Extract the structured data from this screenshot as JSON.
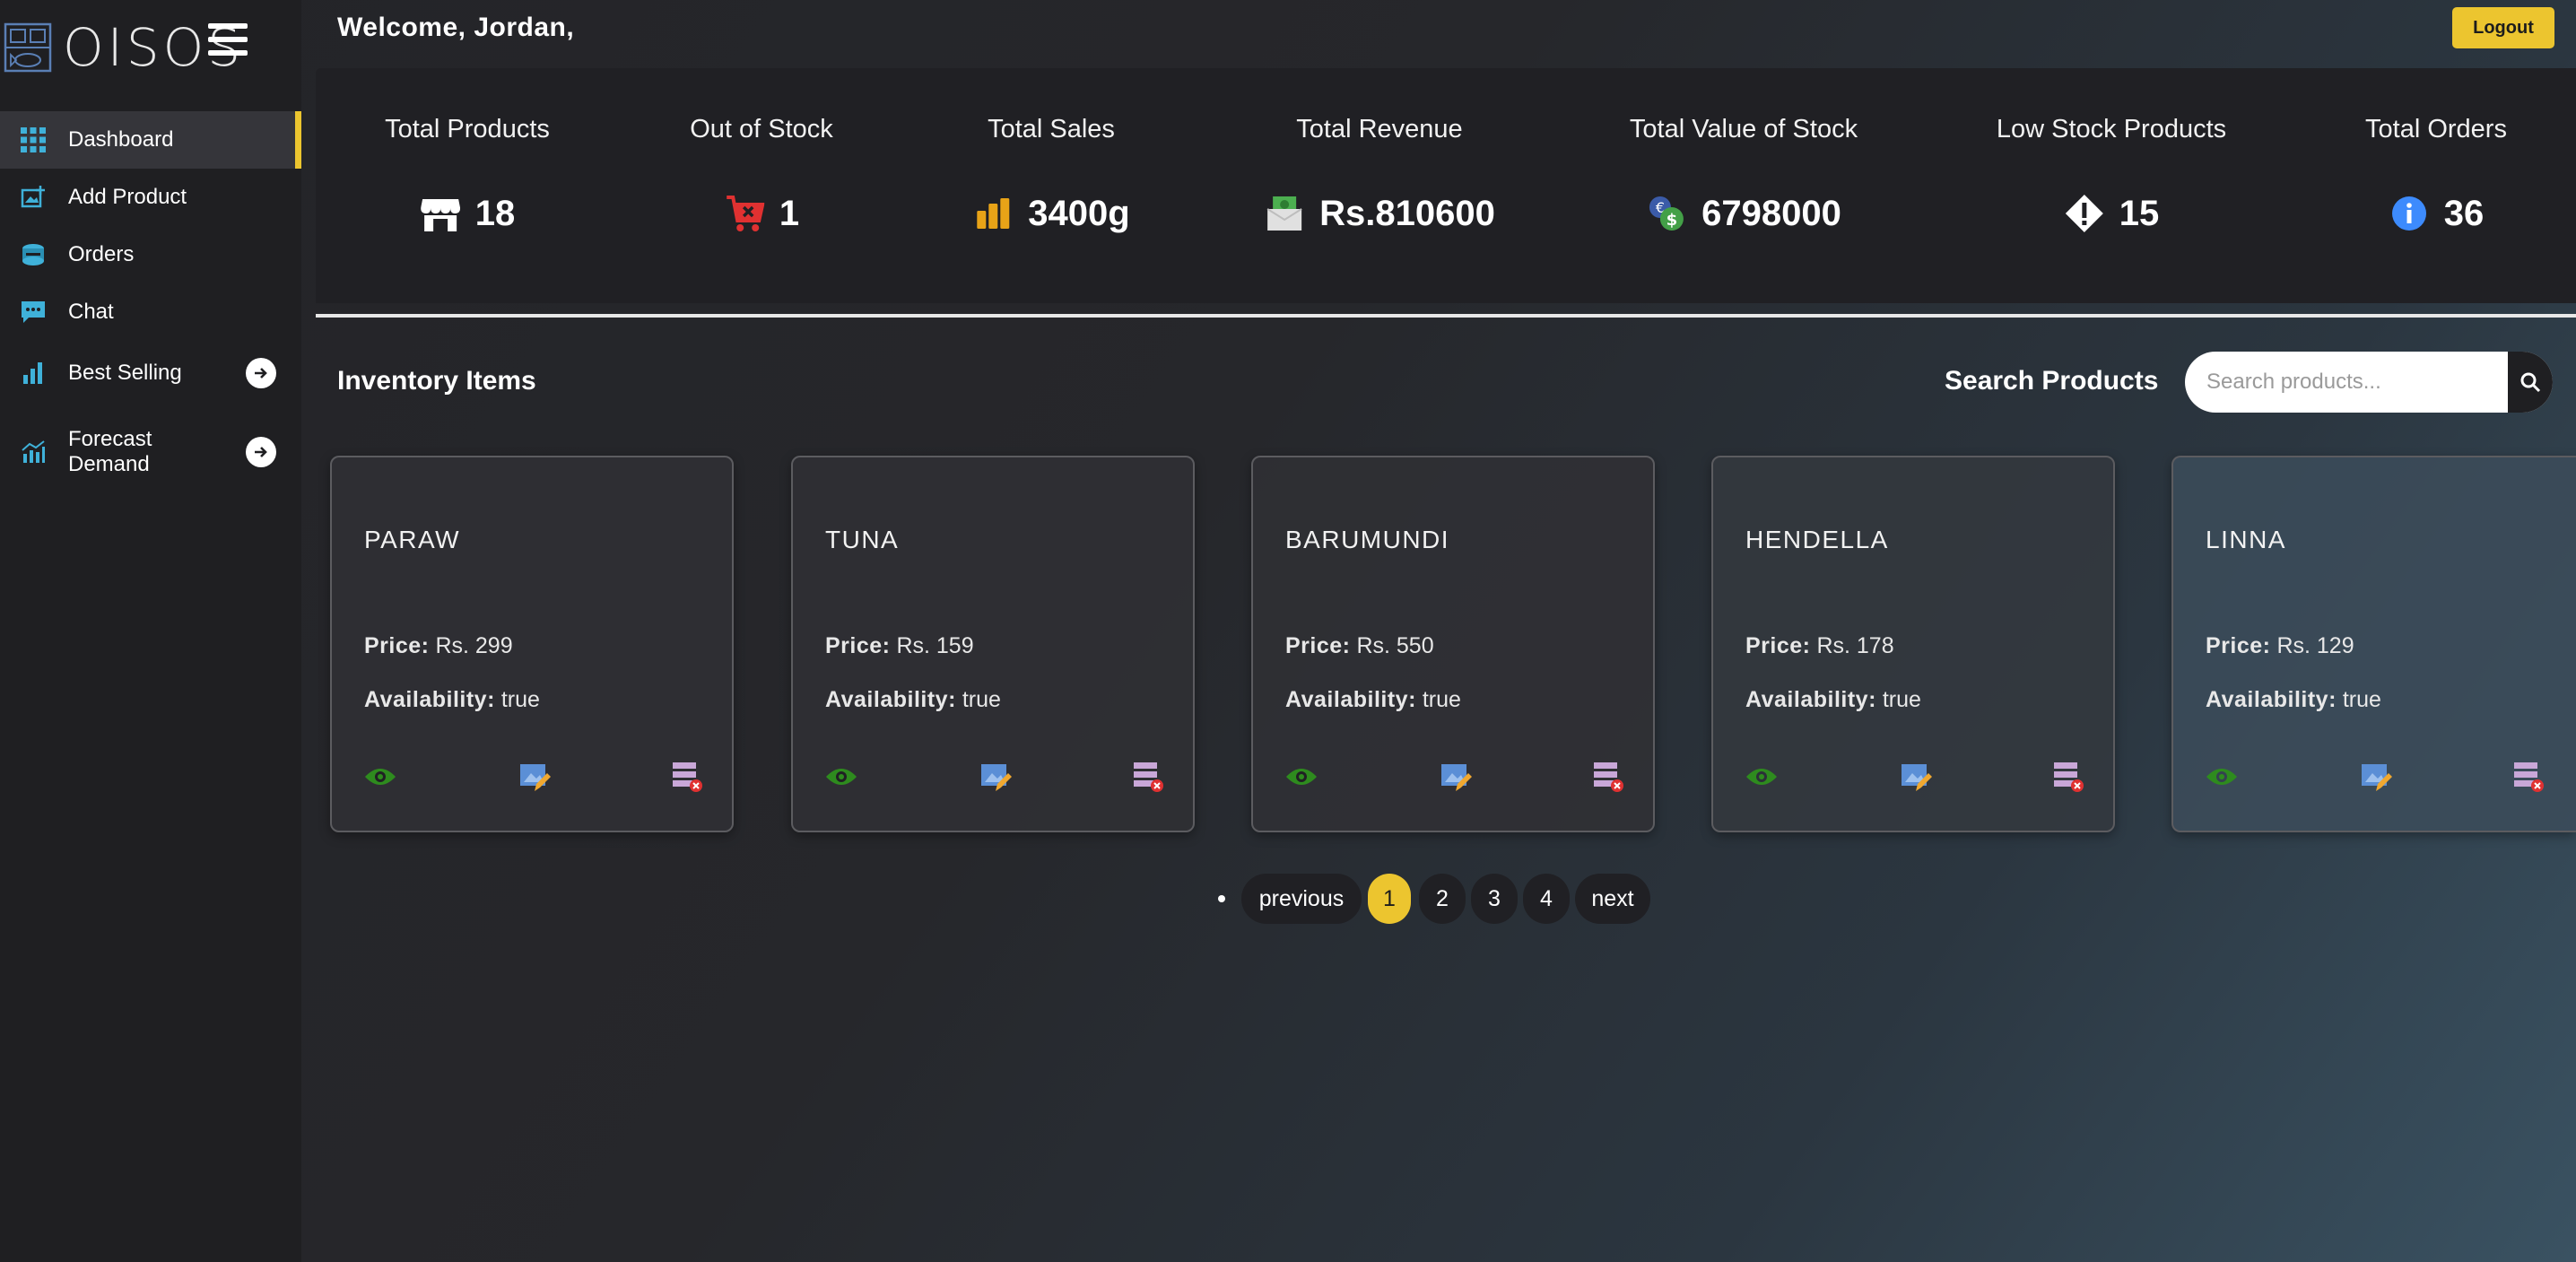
{
  "app": {
    "logo_text": "OISOS"
  },
  "sidebar": {
    "items": [
      {
        "label": "Dashboard",
        "icon": "grid-icon",
        "active": true
      },
      {
        "label": "Add Product",
        "icon": "add-image-icon"
      },
      {
        "label": "Orders",
        "icon": "orders-icon"
      },
      {
        "label": "Chat",
        "icon": "chat-icon"
      },
      {
        "label": "Best Selling",
        "icon": "bar-chart-icon",
        "has_arrow": true
      },
      {
        "label": "Forecast Demand",
        "icon": "forecast-chart-icon",
        "has_arrow": true
      }
    ]
  },
  "header": {
    "welcome": "Welcome, Jordan,",
    "logout_label": "Logout"
  },
  "stats": [
    {
      "label": "Total Products",
      "value": "18",
      "icon": "store-icon"
    },
    {
      "label": "Out of Stock",
      "value": "1",
      "icon": "cart-remove-icon"
    },
    {
      "label": "Total Sales",
      "value": "3400g",
      "icon": "bar-chart-icon"
    },
    {
      "label": "Total Revenue",
      "value": "Rs.810600",
      "icon": "money-box-icon"
    },
    {
      "label": "Total Value of Stock",
      "value": "6798000",
      "icon": "coins-icon"
    },
    {
      "label": "Low Stock Products",
      "value": "15",
      "icon": "warning-diamond-icon"
    },
    {
      "label": "Total Orders",
      "value": "36",
      "icon": "info-icon"
    }
  ],
  "inventory": {
    "title": "Inventory Items",
    "search_label": "Search Products",
    "search_placeholder": "Search products...",
    "price_label": "Price:",
    "availability_label": "Availability:",
    "items": [
      {
        "name": "PARAW",
        "price": "Rs. 299",
        "availability": "true"
      },
      {
        "name": "TUNA",
        "price": "Rs. 159",
        "availability": "true"
      },
      {
        "name": "BARUMUNDI",
        "price": "Rs. 550",
        "availability": "true"
      },
      {
        "name": "HENDELLA",
        "price": "Rs. 178",
        "availability": "true"
      },
      {
        "name": "LINNA",
        "price": "Rs. 129",
        "availability": "true"
      }
    ]
  },
  "pagination": {
    "previous_label": "previous",
    "next_label": "next",
    "pages": [
      "1",
      "2",
      "3",
      "4"
    ],
    "current_page": "1"
  },
  "colors": {
    "accent": "#ecc52f",
    "sidebar_bg": "#1f1f22",
    "panel_bg": "#202024",
    "view_icon": "#2e8b1e",
    "delete_icon": "#e03131"
  }
}
